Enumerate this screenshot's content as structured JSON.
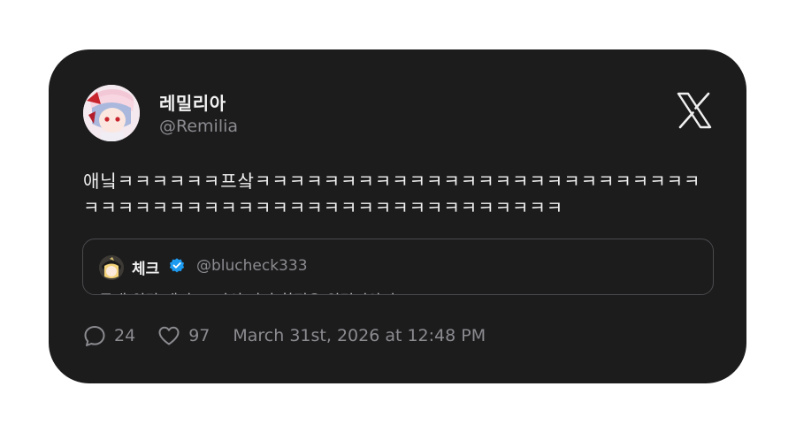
{
  "author": {
    "display_name": "레밀리아",
    "handle": "@Remilia"
  },
  "tweet": {
    "text": "애닠ㅋㅋㅋㅋㅋㅋ프샄ㅋㅋㅋㅋㅋㅋㅋㅋㅋㅋㅋㅋㅋㅋㅋㅋㅋㅋㅋㅋㅋㅋㅋㅋㅋㅋㅋㅋㅋㅋㅋㅋㅋㅋㅋㅋㅋㅋㅋㅋㅋㅋㅋㅋㅋㅋㅋㅋㅋㅋㅋㅋㅋㅋ"
  },
  "quote": {
    "name": "체크",
    "handle": "@blucheck333",
    "text": "무대 위란 애니 그 자의 나가 화평은 원덧이와이"
  },
  "metrics": {
    "replies": "24",
    "likes": "97"
  },
  "timestamp": "March 31st, 2026 at 12:48 PM",
  "colors": {
    "card_bg": "#1c1c1d",
    "verified": "#1d9bf0",
    "muted_text": "#8b8b90"
  },
  "icons": [
    "x-logo-icon",
    "verified-badge-icon",
    "reply-icon",
    "like-icon"
  ]
}
